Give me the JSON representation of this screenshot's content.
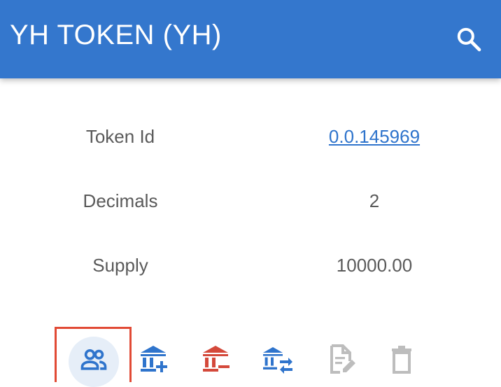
{
  "header": {
    "title": "YH TOKEN (YH)",
    "search_icon": "search-icon"
  },
  "details": [
    {
      "label": "Token Id",
      "value": "0.0.145969",
      "is_link": true
    },
    {
      "label": "Decimals",
      "value": "2",
      "is_link": false
    },
    {
      "label": "Supply",
      "value": "10000.00",
      "is_link": false
    }
  ],
  "toolbar": {
    "buttons": [
      {
        "icon": "people-icon",
        "color": "#2f74cc",
        "selected": true
      },
      {
        "icon": "bank-add-icon",
        "color": "#2f74cc"
      },
      {
        "icon": "bank-remove-icon",
        "color": "#d4493b"
      },
      {
        "icon": "bank-transfer-icon",
        "color": "#2f74cc"
      },
      {
        "icon": "edit-document-icon",
        "color": "#bdbdbd"
      },
      {
        "icon": "trash-icon",
        "color": "#bdbdbd"
      }
    ]
  },
  "colors": {
    "appbar": "#3477cd",
    "link": "#2f74cc",
    "danger": "#d4493b",
    "disabled": "#bdbdbd",
    "highlight": "#e14a35"
  }
}
